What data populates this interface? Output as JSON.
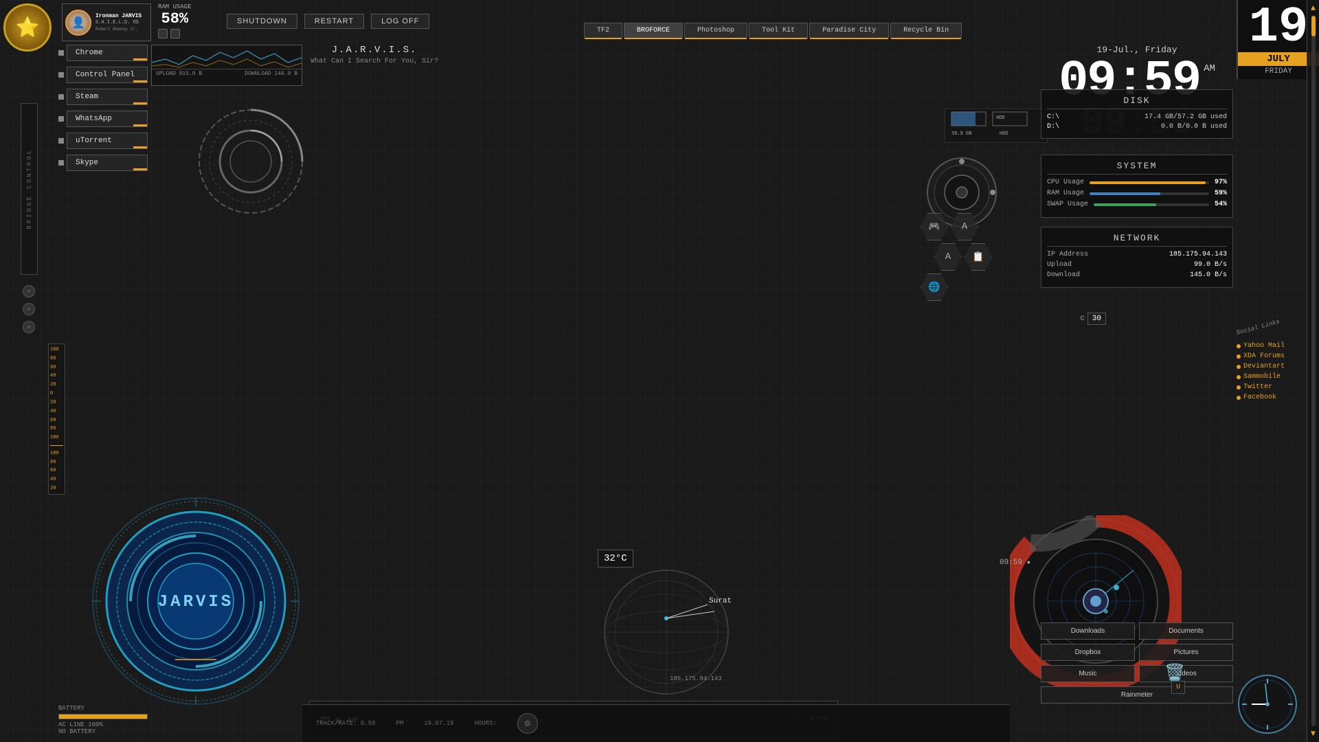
{
  "user": {
    "name": "Ironman JARVIS",
    "shield": "S.H.I.E.L.D. OS",
    "sub": "Robert Downey Jr.",
    "avatar": "👤"
  },
  "ram": {
    "label": "RAM USAGE",
    "value": "58%"
  },
  "power": {
    "shutdown": "SHUTDOWN",
    "restart": "RESTART",
    "logoff": "LOG OFF"
  },
  "nav_tabs": [
    "TF2",
    "BROFORCE",
    "Photoshop",
    "Tool Kit",
    "Paradise City",
    "Recycle Bin"
  ],
  "date": {
    "day": "19",
    "month": "JULY",
    "weekday": "FRIDAY",
    "full": "19-Jul., Friday"
  },
  "clock": {
    "time": "09:59",
    "ampm": "AM",
    "shadow": "09:59"
  },
  "apps": [
    {
      "label": "Chrome"
    },
    {
      "label": "Control Panel"
    },
    {
      "label": "Steam"
    },
    {
      "label": "WhatsApp"
    },
    {
      "label": "uTorrent"
    },
    {
      "label": "Skype"
    }
  ],
  "jarvis": {
    "title": "J.A.R.V.I.S.",
    "subtitle": "What Can I Search For You, Sir?",
    "main_label": "JARVIS"
  },
  "upload_stats": {
    "upload_label": "UPLOAD",
    "upload_value": "915.0 B",
    "download_label": "DOWNLOAD",
    "download_value": "146.0 B"
  },
  "disk": {
    "title": "DISK",
    "drives": [
      {
        "path": "C:\\",
        "size": "17.4 GB/57.2 GB used"
      },
      {
        "path": "D:\\",
        "size": "0.0 B/0.0 B used"
      }
    ]
  },
  "system": {
    "title": "SYSTEM",
    "cpu_label": "CPU Usage",
    "cpu_value": "97%",
    "cpu_pct": 97,
    "ram_label": "RAM Usage",
    "ram_value": "59%",
    "ram_pct": 59,
    "swap_label": "SWAP Usage",
    "swap_value": "54%",
    "swap_pct": 54
  },
  "network": {
    "title": "NETWORK",
    "ip_label": "IP Address",
    "ip_value": "185.175.94.143",
    "upload_label": "Upload",
    "upload_value": "99.0 B/s",
    "download_label": "Download",
    "download_value": "145.0 B/s"
  },
  "social": [
    "Yahoo Mail",
    "XDA Forums",
    "Deviantart",
    "Sammobile",
    "Twitter",
    "Facebook"
  ],
  "weather": {
    "temp": "32°C",
    "city": "Surat",
    "ip": "185.175.94.143"
  },
  "quick_links": [
    [
      "Downloads",
      "Documents"
    ],
    [
      "Dropbox",
      "Pictures"
    ],
    [
      "Music",
      "Videos"
    ],
    [
      "Rainmeter",
      ""
    ]
  ],
  "music": {
    "prev": "⏮",
    "play": "▶",
    "next": "⏭",
    "time": "0:00",
    "elapsed": "0:00"
  },
  "bridge_label": "BRIDGE CONTROL",
  "battery": {
    "label": "BATTERY",
    "ac_line": "AC LINE 100%",
    "status": "NO BATTERY"
  },
  "meter_values": [
    "100",
    "80",
    "60",
    "40",
    "20",
    "0",
    "20",
    "40",
    "60",
    "80",
    "100",
    "100",
    "80",
    "60",
    "40",
    "20"
  ],
  "notif": {
    "count": "30",
    "prefix": "C"
  }
}
